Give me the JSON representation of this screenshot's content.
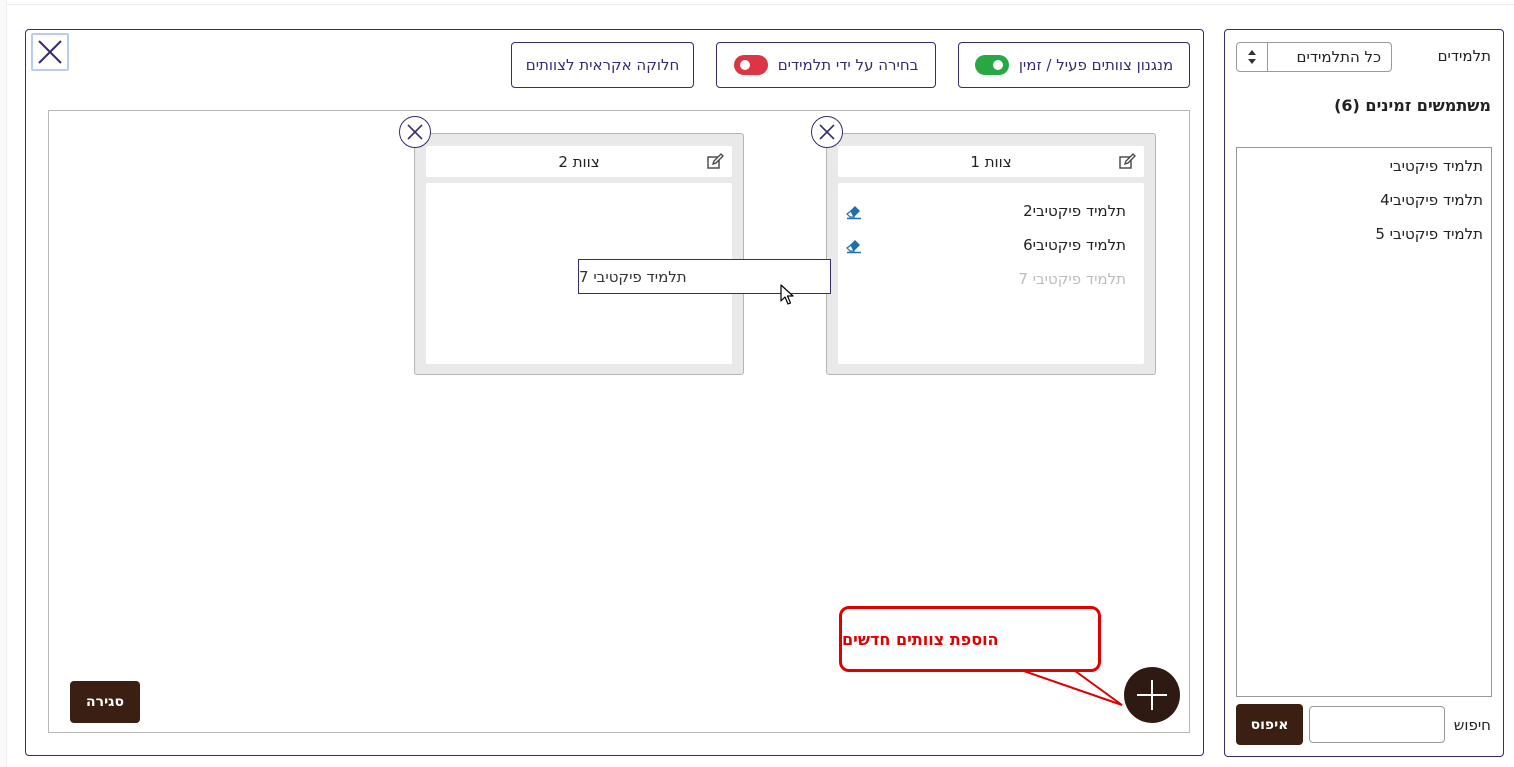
{
  "toolbar": {
    "active_time_label": "מנגנון צוותים פעיל / זמין",
    "active_time_on": true,
    "student_choice_label": "בחירה על ידי תלמידים",
    "student_choice_on": false,
    "random_split_label": "חלוקה אקראית לצוותים"
  },
  "teams": [
    {
      "title": "צוות 1",
      "members": [
        "תלמיד פיקטיבי2",
        "תלמיד פיקטיבי6"
      ],
      "ghost_member": "תלמיד פיקטיבי 7"
    },
    {
      "title": "צוות 2",
      "members": []
    }
  ],
  "drag_item": "תלמיד פיקטיבי 7",
  "callout": {
    "text": "הוספת צוותים חדשים"
  },
  "buttons": {
    "close_label": "סגירה",
    "reset_label": "איפוס"
  },
  "sidebar": {
    "students_label": "תלמידים",
    "filter_value": "כל התלמידים",
    "available_title": "משתמשים זמינים (6)",
    "users": [
      "תלמיד פיקטיבי",
      "תלמיד פיקטיבי4",
      "תלמיד פיקטיבי 5"
    ],
    "search_label": "חיפוש",
    "search_value": ""
  },
  "colors": {
    "accent": "#3b2a6e",
    "toggle_on": "#28a745",
    "toggle_off": "#dc3545",
    "dark_button": "#3a1f12",
    "callout": "#e00000",
    "eraser": "#1f6fb0"
  },
  "icons": {
    "close": "close-icon",
    "edit": "edit-icon",
    "eraser": "eraser-icon",
    "add": "plus-icon",
    "sort": "sort-arrows-icon",
    "cursor": "mouse-pointer-icon"
  }
}
